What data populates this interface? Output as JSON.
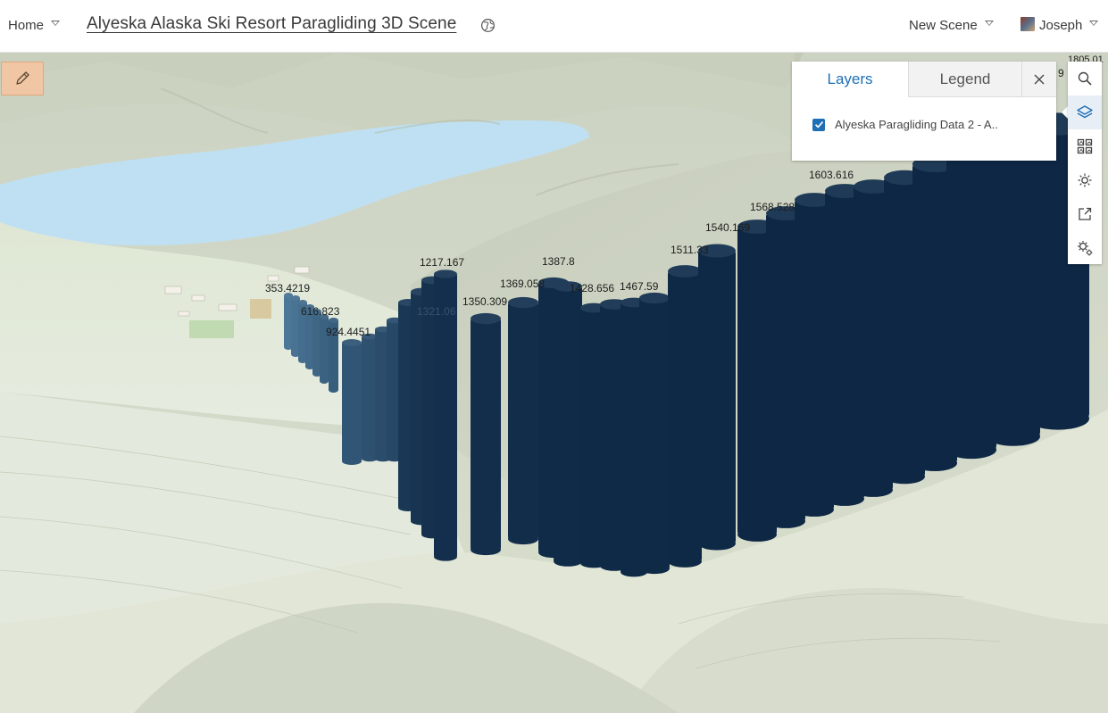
{
  "header": {
    "home_label": "Home",
    "scene_title": "Alyeska Alaska Ski Resort Paragliding 3D Scene",
    "new_scene_label": "New Scene",
    "user_name": "Joseph"
  },
  "panel": {
    "tabs": [
      "Layers",
      "Legend"
    ],
    "active_tab": "Layers",
    "layers": [
      {
        "name": "Alyeska Paragliding Data 2 - A..",
        "visible": true
      }
    ]
  },
  "toolbar": {
    "tools": [
      "search-icon",
      "layers-icon",
      "basemap-gallery-icon",
      "daylight-icon",
      "share-icon",
      "settings-icon"
    ],
    "active_tool": "layers-icon"
  },
  "map": {
    "value_labels": [
      "353.4219",
      "616.823",
      "924.4451",
      "1217.167",
      "1321.06",
      "1350.309",
      "1369.058",
      "1387.8",
      "1428.656",
      "1467.59",
      "1511.33",
      "1540.169",
      "1568.528",
      "1603.616",
      "1805.01",
      "9"
    ],
    "colors": {
      "column_dark": "#0d2744",
      "column_light": "#4f7b9b",
      "water": "#bfe0f2",
      "terrain": "#d8dfcc",
      "edit_button": "#f1c6a5",
      "accent": "#1f6fb5"
    }
  }
}
